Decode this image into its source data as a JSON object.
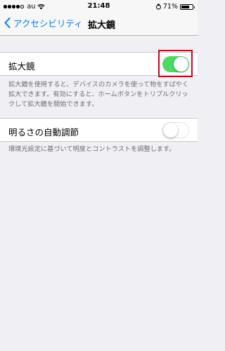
{
  "statusbar": {
    "carrier": "au",
    "time": "21:48",
    "battery": "71%",
    "battery_level": 0.71
  },
  "navbar": {
    "back_label": "アクセシビリティ",
    "title": "拡大鏡"
  },
  "magnifier": {
    "label": "拡大鏡",
    "enabled": true,
    "note": "拡大鏡を使用すると、デバイスのカメラを使って物をすばやく拡大できます。有効にすると、ホームボタンをトリプルクリックして拡大鏡を開始できます。"
  },
  "auto_brightness": {
    "label": "明るさの自動調節",
    "enabled": false,
    "note": "環境光設定に基づいて明度とコントラストを調整します。"
  },
  "colors": {
    "accent": "#007aff",
    "toggle_on": "#4cd964",
    "highlight": "#e0001b"
  }
}
